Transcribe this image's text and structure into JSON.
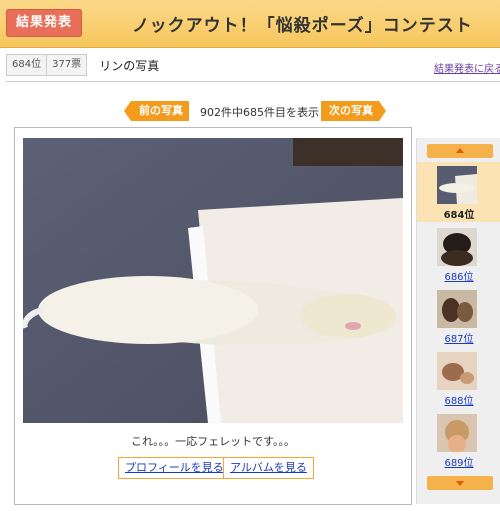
{
  "banner": {
    "tag": "結果発表",
    "title": "ノックアウト！「悩殺ポーズ」コンテスト"
  },
  "info": {
    "rank": "684位",
    "votes": "377票",
    "photo_title": "リンの写真",
    "back_link": "結果発表に戻る"
  },
  "pager": {
    "prev_label": "前の写真",
    "next_label": "次の写真",
    "count_text": "902件中685件目を表示"
  },
  "photo": {
    "caption": "これ。。。一応フェレットです。。。"
  },
  "links": {
    "profile": "プロフィールを見る",
    "album": "アルバムを見る"
  },
  "thumbs": [
    {
      "rank": "684位",
      "active": true
    },
    {
      "rank": "686位",
      "active": false
    },
    {
      "rank": "687位",
      "active": false
    },
    {
      "rank": "688位",
      "active": false
    },
    {
      "rank": "689位",
      "active": false
    }
  ],
  "colors": {
    "accent": "#f39b1c",
    "banner_tag": "#e8705a",
    "link": "#1a3bc4"
  }
}
